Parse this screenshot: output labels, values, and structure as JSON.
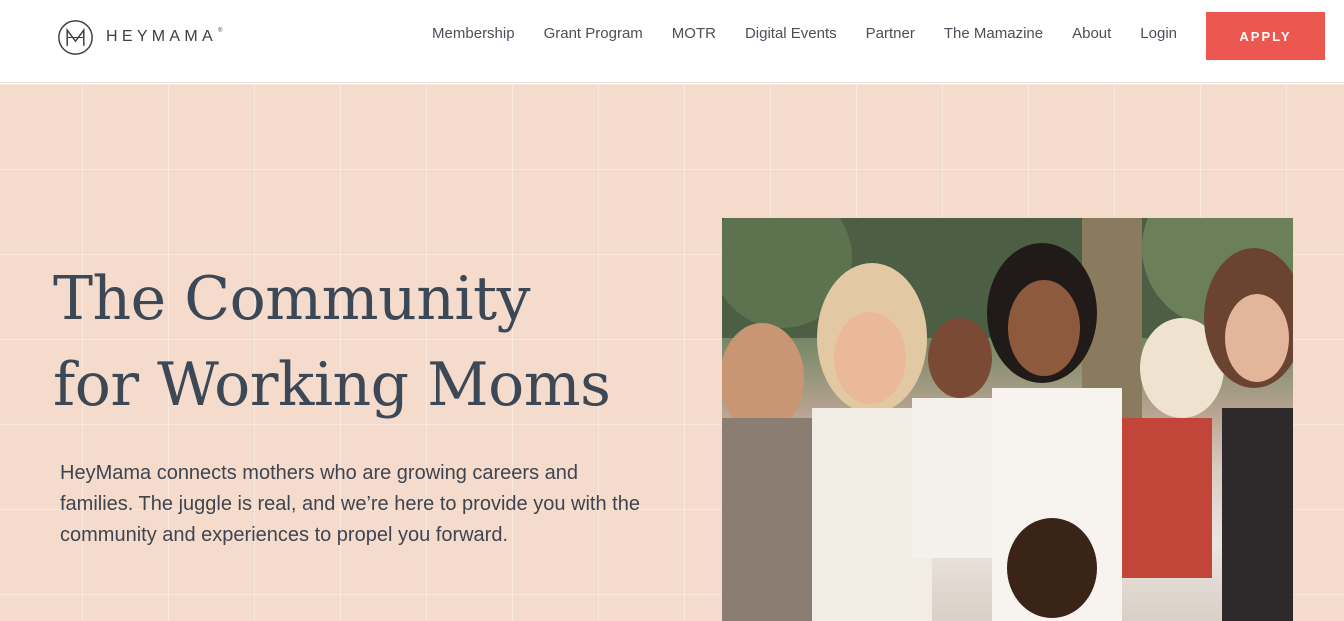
{
  "brand": {
    "name": "HEYMAMA",
    "reg_mark": "®",
    "logo_letter": "M"
  },
  "nav": {
    "items": [
      {
        "label": "Membership"
      },
      {
        "label": "Grant Program"
      },
      {
        "label": "MOTR"
      },
      {
        "label": "Digital Events"
      },
      {
        "label": "Partner"
      },
      {
        "label": "The Mamazine"
      },
      {
        "label": "About"
      },
      {
        "label": "Login"
      }
    ],
    "cta_label": "APPLY"
  },
  "hero": {
    "headline_line1": "The Community",
    "headline_line2": "for Working Moms",
    "description": "HeyMama connects mothers who are growing careers and families. The juggle is real, and we’re here to provide you with the community and experiences to propel you forward.",
    "photo_icon": "group-photo-of-moms-and-children"
  },
  "colors": {
    "accent": "#ec574f",
    "hero_bg": "#f4dbcc",
    "headline": "#3c4856",
    "text": "#3e4550"
  }
}
